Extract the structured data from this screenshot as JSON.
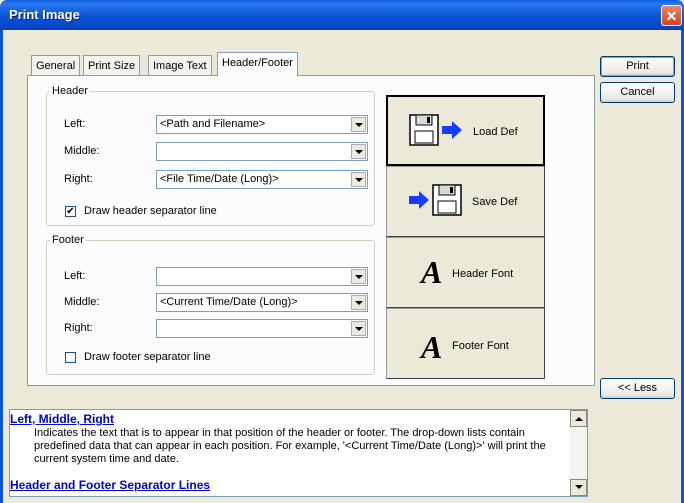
{
  "window": {
    "title": "Print Image",
    "close_glyph": "✕"
  },
  "tabs": [
    "General",
    "Print Size",
    "Image Text",
    "Header/Footer"
  ],
  "active_tab": "Header/Footer",
  "header": {
    "legend": "Header",
    "left_label": "Left:",
    "left_value": "<Path and Filename>",
    "middle_label": "Middle:",
    "middle_value": "",
    "right_label": "Right:",
    "right_value": "<File Time/Date (Long)>",
    "separator_label": "Draw header separator line",
    "separator_checked": true
  },
  "footer": {
    "legend": "Footer",
    "left_label": "Left:",
    "left_value": "",
    "middle_label": "Middle:",
    "middle_value": "<Current Time/Date (Long)>",
    "right_label": "Right:",
    "right_value": "",
    "separator_label": "Draw footer separator line",
    "separator_checked": false
  },
  "actions": {
    "load_def": "Load Def",
    "save_def": "Save Def",
    "header_font": "Header Font",
    "footer_font": "Footer Font",
    "font_glyph": "A"
  },
  "buttons": {
    "print": "Print",
    "cancel": "Cancel",
    "less": "<< Less"
  },
  "help": {
    "heading1": "Left, Middle, Right",
    "body1": "Indicates the text that is to appear in that position of the header or footer.  The drop-down lists contain predefined data that can appear in each position.  For example, '<Current Time/Date (Long)>' will print the current system time and date.",
    "heading2": "Header and Footer Separator Lines"
  },
  "colors": {
    "titlebar": "#0b56d8",
    "close": "#d1451f",
    "help_heading": "#0000c8",
    "arrow": "#1a3cff"
  }
}
